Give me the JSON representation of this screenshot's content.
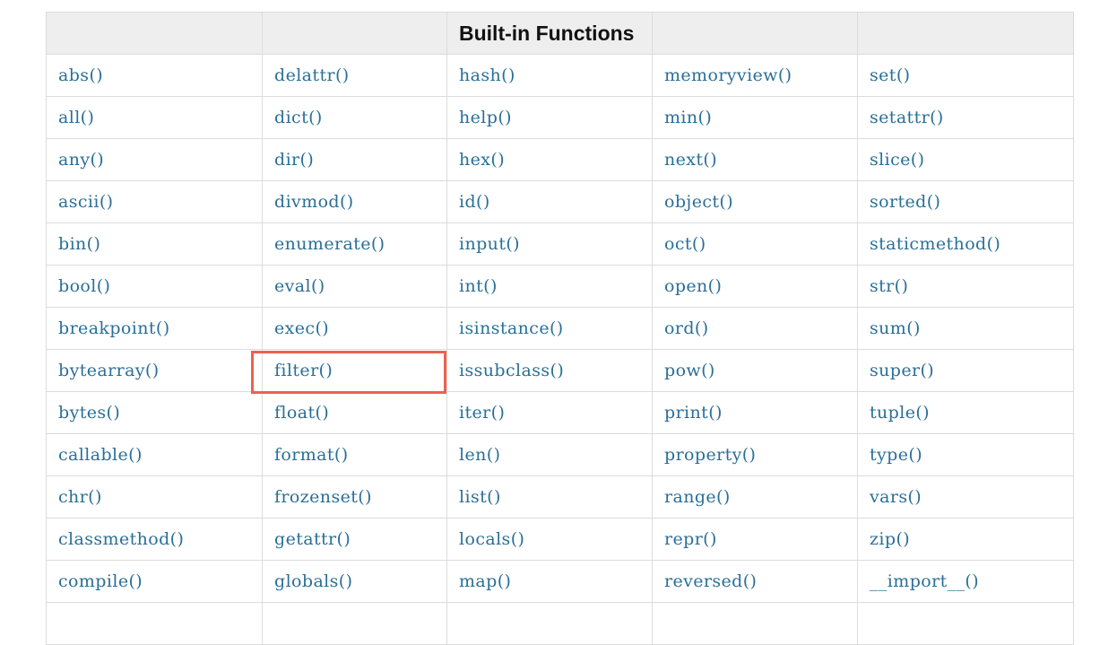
{
  "table": {
    "header": [
      "",
      "",
      "Built-in Functions",
      "",
      ""
    ],
    "rows": [
      [
        "abs()",
        "delattr()",
        "hash()",
        "memoryview()",
        "set()"
      ],
      [
        "all()",
        "dict()",
        "help()",
        "min()",
        "setattr()"
      ],
      [
        "any()",
        "dir()",
        "hex()",
        "next()",
        "slice()"
      ],
      [
        "ascii()",
        "divmod()",
        "id()",
        "object()",
        "sorted()"
      ],
      [
        "bin()",
        "enumerate()",
        "input()",
        "oct()",
        "staticmethod()"
      ],
      [
        "bool()",
        "eval()",
        "int()",
        "open()",
        "str()"
      ],
      [
        "breakpoint()",
        "exec()",
        "isinstance()",
        "ord()",
        "sum()"
      ],
      [
        "bytearray()",
        "filter()",
        "issubclass()",
        "pow()",
        "super()"
      ],
      [
        "bytes()",
        "float()",
        "iter()",
        "print()",
        "tuple()"
      ],
      [
        "callable()",
        "format()",
        "len()",
        "property()",
        "type()"
      ],
      [
        "chr()",
        "frozenset()",
        "list()",
        "range()",
        "vars()"
      ],
      [
        "classmethod()",
        "getattr()",
        "locals()",
        "repr()",
        "zip()"
      ],
      [
        "compile()",
        "globals()",
        "map()",
        "reversed()",
        "__import__()"
      ],
      [
        "",
        "",
        "",
        "",
        ""
      ]
    ],
    "highlighted": "filter()"
  },
  "colors": {
    "link": "#2a6f97",
    "header_bg": "#eeeeee",
    "border": "#dcdcdc",
    "highlight": "#f0604d"
  }
}
